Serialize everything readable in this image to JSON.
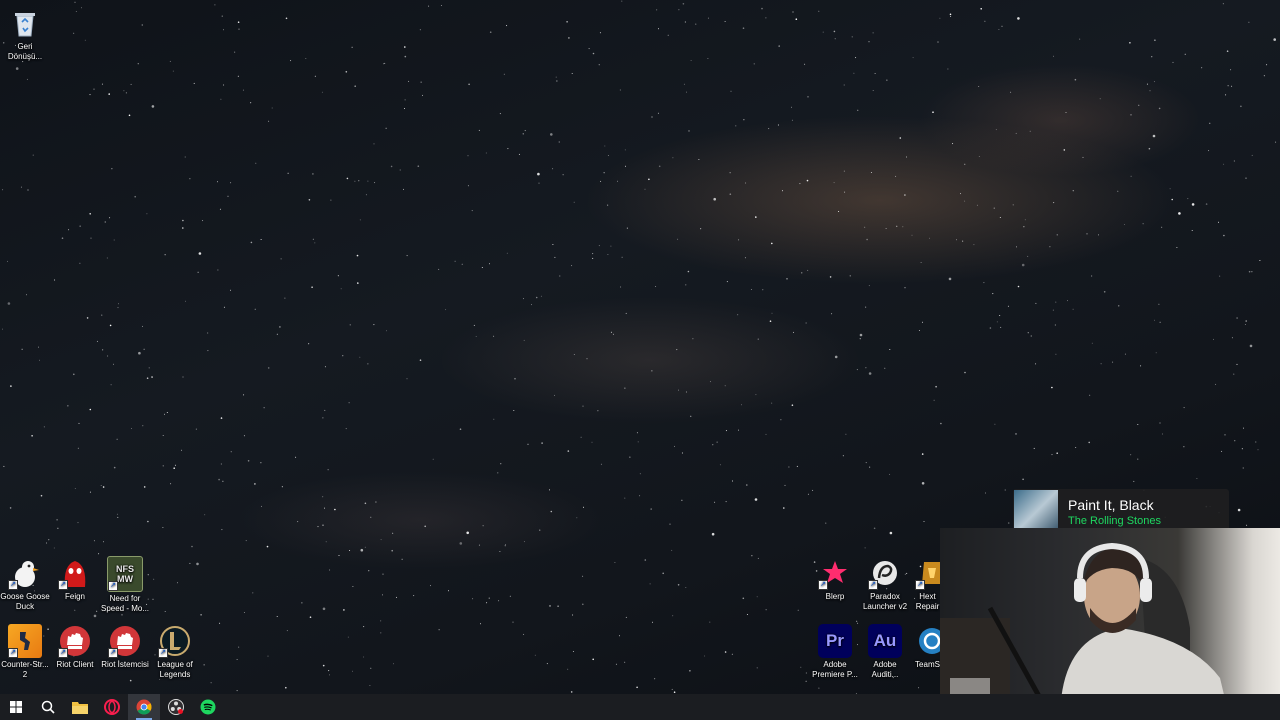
{
  "desktop": {
    "icons": [
      {
        "name": "recycle-bin-icon",
        "label": "Geri Dönüşü..."
      },
      {
        "name": "goose-goose-duck-icon",
        "label": "Goose Goose Duck"
      },
      {
        "name": "feign-icon",
        "label": "Feign"
      },
      {
        "name": "need-for-speed-icon",
        "label": "Need for Speed - Mo..."
      },
      {
        "name": "counter-strike-icon",
        "label": "Counter-Str... 2"
      },
      {
        "name": "riot-client-icon",
        "label": "Riot Client"
      },
      {
        "name": "riot-istemcisi-icon",
        "label": "Riot İstemcisi"
      },
      {
        "name": "league-of-legends-icon",
        "label": "League of Legends"
      },
      {
        "name": "blerp-icon",
        "label": "Blerp"
      },
      {
        "name": "paradox-launcher-icon",
        "label": "Paradox Launcher v2"
      },
      {
        "name": "hextech-repair-icon",
        "label": "Hext Repair"
      },
      {
        "name": "adobe-premiere-icon",
        "label": "Adobe Premiere P..."
      },
      {
        "name": "adobe-audition-icon",
        "label": "Adobe Auditi..."
      },
      {
        "name": "teamspeak-icon",
        "label": "TeamS"
      }
    ],
    "icon_texts": {
      "nfs": "NFS MW",
      "premiere": "Pr",
      "audition": "Au"
    }
  },
  "now_playing": {
    "title": "Paint It, Black",
    "artist": "The Rolling Stones"
  },
  "taskbar": {
    "items": [
      {
        "name": "start-icon"
      },
      {
        "name": "search-icon"
      },
      {
        "name": "file-explorer-icon"
      },
      {
        "name": "opera-gx-icon"
      },
      {
        "name": "chrome-icon",
        "active": true
      },
      {
        "name": "obs-icon"
      },
      {
        "name": "spotify-icon"
      }
    ]
  },
  "colors": {
    "taskbar": "#1b1d21",
    "spotify_green": "#1ed760",
    "premiere": "#9999ff",
    "audition": "#00e4bb"
  }
}
